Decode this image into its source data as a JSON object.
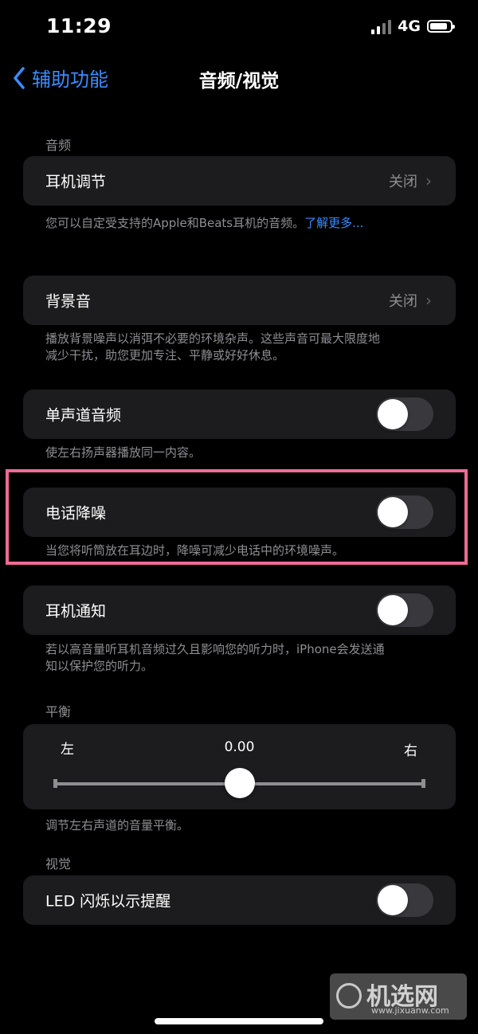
{
  "status": {
    "time": "11:29",
    "network": "4G"
  },
  "nav": {
    "back_label": "辅助功能",
    "title": "音频/视觉"
  },
  "sections": {
    "audio": "音频",
    "balance": "平衡",
    "visual": "视觉"
  },
  "headphone_accommodations": {
    "label": "耳机调节",
    "value": "关闭",
    "footnote": "您可以自定受支持的Apple和Beats耳机的音频。",
    "link": "了解更多..."
  },
  "background_sounds": {
    "label": "背景音",
    "value": "关闭",
    "footnote_line1": "播放背景噪声以消弭不必要的环境杂声。这些声音可最大限度地",
    "footnote_line2": "减少干扰，助您更加专注、平静或好好休息。"
  },
  "mono_audio": {
    "label": "单声道音频",
    "on": false,
    "footnote": "使左右扬声器播放同一内容。"
  },
  "phone_noise_cancellation": {
    "label": "电话降噪",
    "on": false,
    "footnote": "当您将听筒放在耳边时，降噪可减少电话中的环境噪声。"
  },
  "headphone_notifications": {
    "label": "耳机通知",
    "on": false,
    "footnote_line1": "若以高音量听耳机音频过久且影响您的听力时，iPhone会发送通",
    "footnote_line2": "知以保护您的听力。"
  },
  "balance": {
    "left": "左",
    "right": "右",
    "value": "0.00",
    "level": 0.5,
    "footnote": "调节左右声道的音量平衡。"
  },
  "led_flash": {
    "label": "LED 闪烁以示提醒",
    "on": false
  },
  "watermark": {
    "main": "机选网",
    "sub": "www.jixuanw.com"
  },
  "colors": {
    "accent": "#3a8cff",
    "highlight": "#f06a95",
    "cell": "#1c1c1e"
  }
}
